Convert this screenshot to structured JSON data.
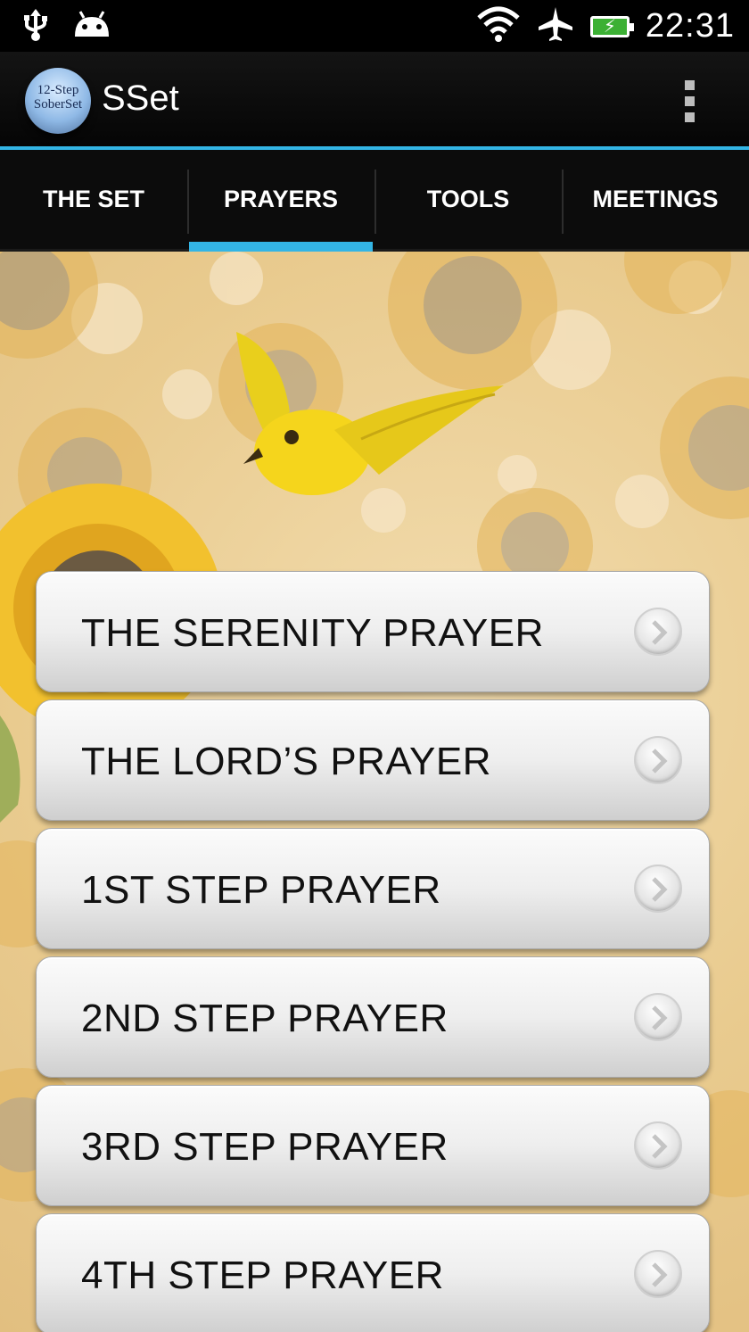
{
  "status_bar": {
    "time": "22:31",
    "icons": [
      "usb-icon",
      "android-icon",
      "wifi-icon",
      "airplane-mode-icon",
      "battery-charging-icon"
    ]
  },
  "action_bar": {
    "logo_line1": "12-Step",
    "logo_line2": "SoberSet",
    "title": "SSet",
    "overflow_icon": "overflow-menu-icon"
  },
  "tabs": [
    {
      "label": "THE SET",
      "selected": false
    },
    {
      "label": "PRAYERS",
      "selected": true
    },
    {
      "label": "TOOLS",
      "selected": false
    },
    {
      "label": "MEETINGS",
      "selected": false
    }
  ],
  "prayers": [
    {
      "label": "THE SERENITY PRAYER"
    },
    {
      "label": "THE LORD’S PRAYER"
    },
    {
      "label": "1ST STEP PRAYER"
    },
    {
      "label": "2ND STEP PRAYER"
    },
    {
      "label": "3RD STEP PRAYER"
    },
    {
      "label": "4TH STEP PRAYER"
    }
  ],
  "colors": {
    "accent": "#33b5e5",
    "background_tan": "#e9cb8f",
    "sunflower_petal": "#f2c12e",
    "bird_yellow": "#f5d51c"
  }
}
